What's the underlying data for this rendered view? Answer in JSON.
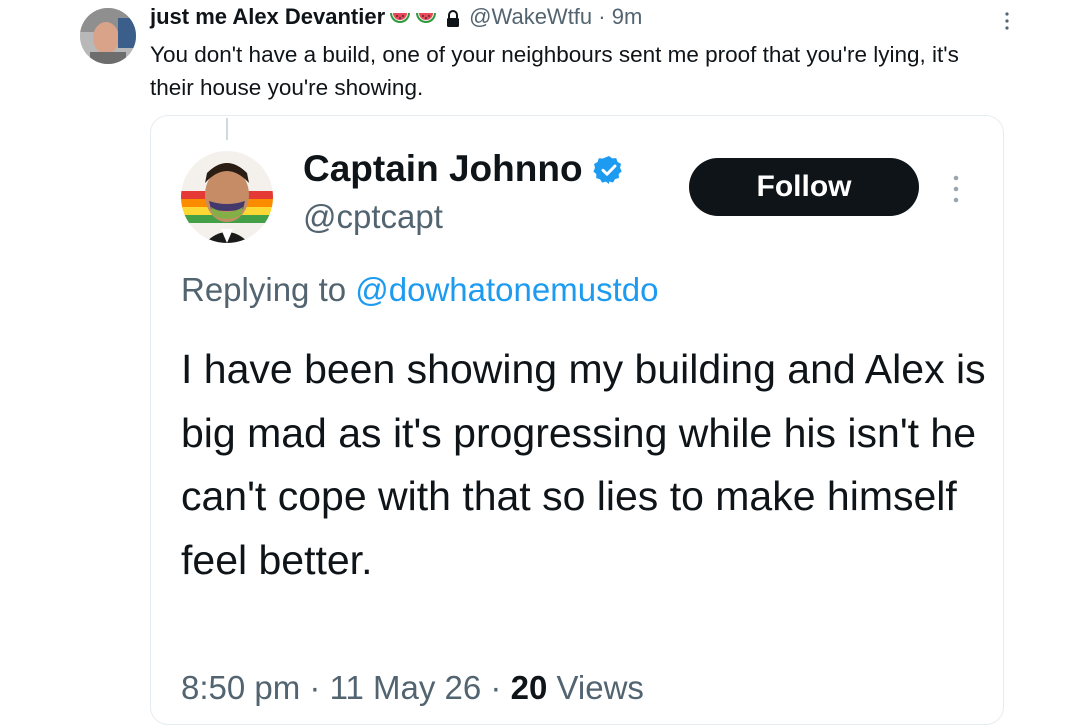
{
  "outer_tweet": {
    "author_name": "just me Alex Devantier",
    "handle": "@WakeWtfu",
    "separator": "·",
    "time": "9m",
    "text": "You don't have a build, one of your neighbours sent me proof that you're lying, it's their house you're showing."
  },
  "quoted_tweet": {
    "author_name": "Captain Johnno",
    "handle": "@cptcapt",
    "follow_label": "Follow",
    "replying_prefix": "Replying to ",
    "replying_mention": "@dowhatonemustdo",
    "text": "I have been showing my building and Alex is big mad as it's progressing while his isn't he can't cope with that so lies to make himself feel better.",
    "time": "8:50 pm",
    "separator": "·",
    "date": "11 May 26",
    "views_count": "20",
    "views_label": "Views"
  },
  "colors": {
    "verified_blue": "#1d9bf0",
    "mention_blue": "#1d9bf0",
    "secondary_text": "#536471",
    "follow_button": "#0f1419"
  },
  "icons": {
    "name_badges": [
      "watermelon-icon",
      "watermelon-icon"
    ],
    "protected": "lock-icon",
    "verified": "verified-badge-icon",
    "more": "more-vertical-icon"
  }
}
